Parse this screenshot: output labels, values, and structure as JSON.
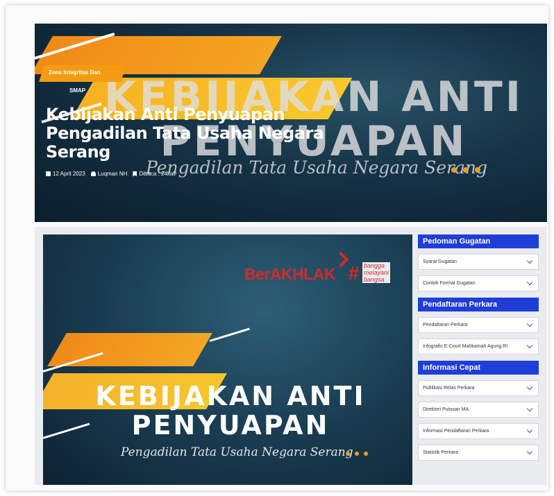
{
  "hero": {
    "category_line1": "Zona Integritas Dan",
    "category_line2": "SMAP",
    "title": "Kebijakan Anti Penyuapan Pengadilan Tata Usaha Negara Serang",
    "bg_title": "KEBIJAKAN ANTI PENYUAPAN",
    "bg_subtitle": "Pengadilan Tata Usaha Negara Serang",
    "meta": {
      "date": "12 April 2023",
      "author": "Luqman NH",
      "views": "Dibaca : 24kali"
    },
    "icons": {
      "date": "calendar-icon",
      "author": "user-icon",
      "views": "bookmark-icon"
    },
    "accent_color": "#f39c12"
  },
  "banner": {
    "brand": "BerAKHLAK",
    "hashtag_words": [
      "bangga",
      "melayani",
      "bangsa"
    ],
    "title_line1": "KEBIJAKAN ANTI",
    "title_line2": "PENYUAPAN",
    "subtitle": "Pengadilan Tata Usaha Negara Serang",
    "brand_color": "#d42a2a"
  },
  "sidebar": {
    "header_color": "#1f3ed8",
    "widgets": [
      {
        "title": "Pedoman Gugatan",
        "items": [
          "Syarat Gugatan",
          "Contoh Format Gugatan"
        ]
      },
      {
        "title": "Pendaftaran Perkara",
        "items": [
          "Pendaftaran Perkara",
          "Infografis E-Court Mahkamah Agung RI"
        ]
      },
      {
        "title": "Informasi Cepat",
        "items": [
          "Publikasi Relas Perkara",
          "Direktori Putusan MA",
          "Informasi Pendaftaran Perkara",
          "Statistik Perkara"
        ]
      }
    ]
  }
}
